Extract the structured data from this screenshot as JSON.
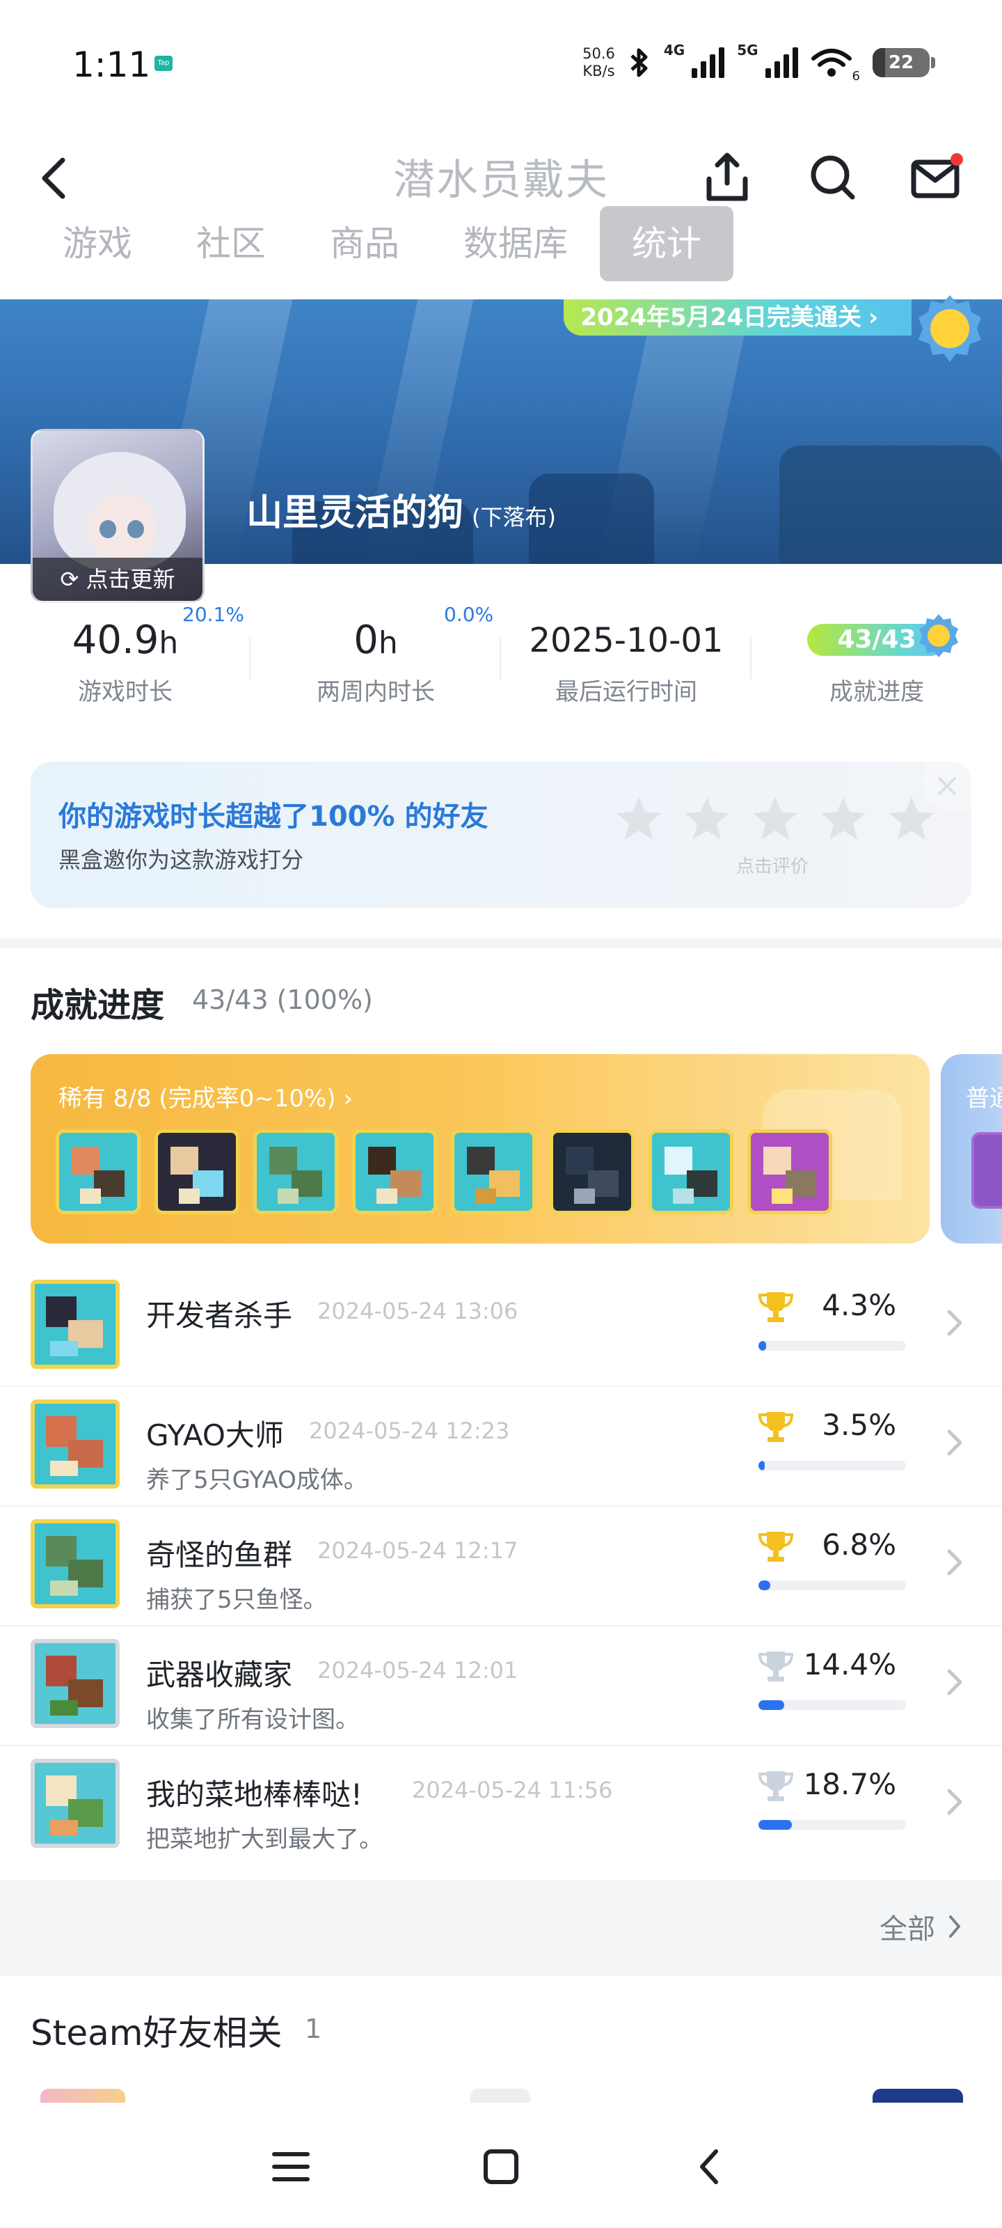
{
  "status_bar": {
    "time": "1:11",
    "app_icon_text": "Tap",
    "net_speed_value": "50.6",
    "net_speed_unit": "KB/s",
    "signal_1": "4G",
    "signal_2": "5G",
    "wifi_sub": "6",
    "battery": "22"
  },
  "nav": {
    "title": "潜水员戴夫",
    "tabs": [
      "游戏",
      "社区",
      "商品",
      "数据库",
      "统计"
    ],
    "active_tab": "统计"
  },
  "hero": {
    "clear_badge": "2024年5月24日完美通关",
    "update_label": "点击更新",
    "username": "山里灵活的狗",
    "username_sub": "(下落布)"
  },
  "stats": {
    "play_time": "40.9",
    "play_time_unit": "h",
    "play_time_pct": "20.1%",
    "play_time_label": "游戏时长",
    "two_week": "0",
    "two_week_unit": "h",
    "two_week_pct": "0.0%",
    "two_week_label": "两周内时长",
    "last_run": "2025-10-01",
    "last_run_label": "最后运行时间",
    "achievement_progress": "43/43",
    "achievement_label": "成就进度"
  },
  "rating": {
    "title": "你的游戏时长超越了100% 的好友",
    "subtitle": "黑盒邀你为这款游戏打分",
    "hint": "点击评价",
    "stars": 5
  },
  "achievements": {
    "title": "成就进度",
    "count": "43/43 (100%)",
    "rare_title": "稀有 8/8 (完成率0~10%)",
    "common_title": "普通",
    "items": [
      {
        "name": "开发者杀手",
        "date": "2024-05-24 13:06",
        "desc": "",
        "rate": "4.3%",
        "rate_value": 4.3,
        "trophy": "gold"
      },
      {
        "name": "GYAO大师",
        "date": "2024-05-24 12:23",
        "desc": "养了5只GYAO成体。",
        "rate": "3.5%",
        "rate_value": 3.5,
        "trophy": "gold"
      },
      {
        "name": "奇怪的鱼群",
        "date": "2024-05-24 12:17",
        "desc": "捕获了5只鱼怪。",
        "rate": "6.8%",
        "rate_value": 6.8,
        "trophy": "gold"
      },
      {
        "name": "武器收藏家",
        "date": "2024-05-24 12:01",
        "desc": "收集了所有设计图。",
        "rate": "14.4%",
        "rate_value": 14.4,
        "trophy": "silver"
      },
      {
        "name": "我的菜地棒棒哒!",
        "date": "2024-05-24 11:56",
        "desc": "把菜地扩大到最大了。",
        "rate": "18.7%",
        "rate_value": 18.7,
        "trophy": "silver"
      }
    ],
    "all_label": "全部"
  },
  "steam_friends": {
    "title": "Steam好友相关",
    "count": "1"
  },
  "colors": {
    "accent_blue": "#2a72f0",
    "rare_orange": "#f6b83f",
    "gold_trophy": "#f2c01f",
    "silver_trophy": "#c9d3de"
  }
}
